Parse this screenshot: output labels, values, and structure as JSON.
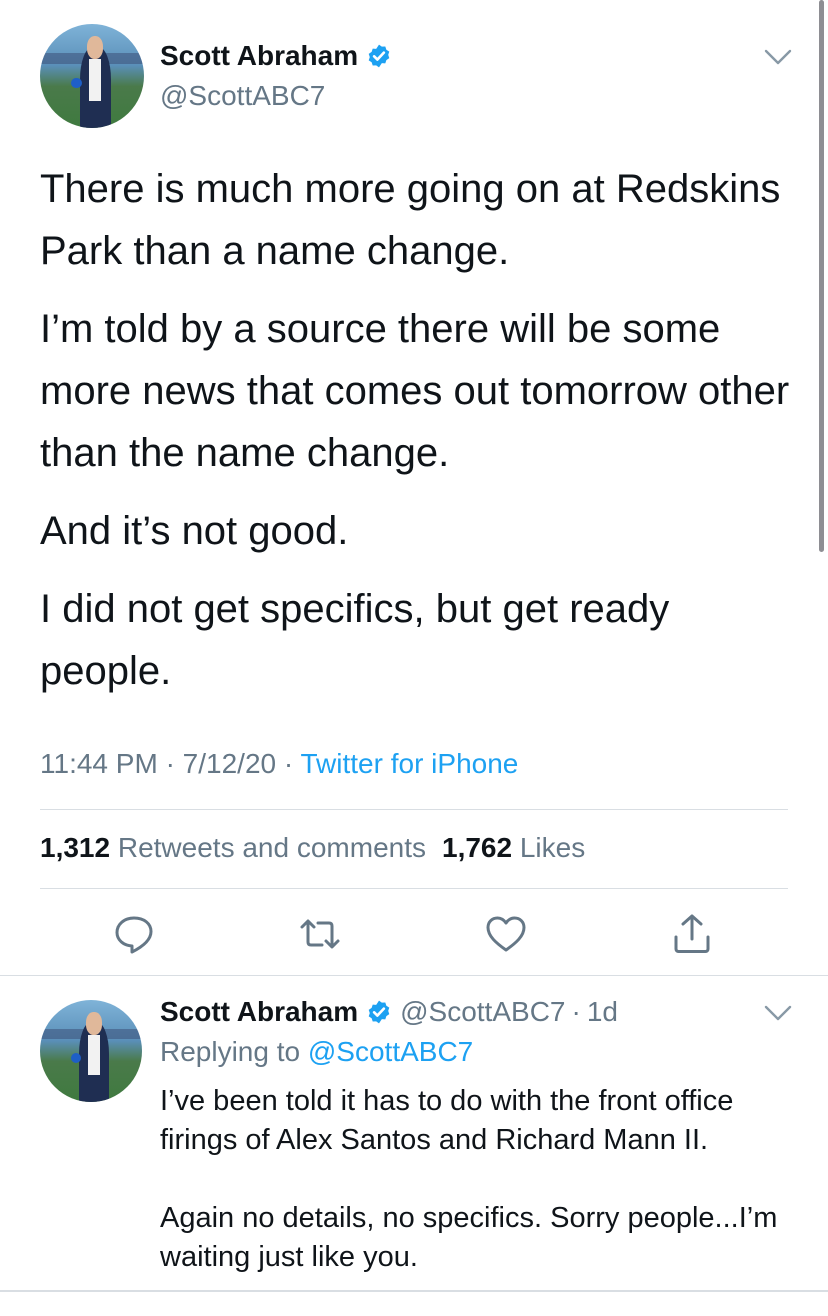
{
  "main_tweet": {
    "author_name": "Scott Abraham",
    "author_handle": "@ScottABC7",
    "paragraphs": [
      "There is much more going on at Redskins Park than a name change.",
      "I’m told by a source there will be some more news that comes out tomorrow other than the name change.",
      "And it’s not good.",
      "I did not get specifics, but get ready people."
    ],
    "time": "11:44 PM",
    "date": "7/12/20",
    "separator": "·",
    "source": "Twitter for iPhone",
    "retweets_count": "1,312",
    "retweets_label": "Retweets and comments",
    "likes_count": "1,762",
    "likes_label": "Likes"
  },
  "reply_tweet": {
    "author_name": "Scott Abraham",
    "author_handle": "@ScottABC7",
    "age": "1d",
    "replying_prefix": "Replying to",
    "replying_to": "@ScottABC7",
    "paragraphs": [
      "I’ve been told it has to do with the front office firings of Alex Santos and Richard Mann II.",
      "Again no details, no specifics. Sorry people...I’m waiting just like you."
    ]
  },
  "icons": {
    "verified": "verified-badge-icon",
    "chevron": "chevron-down-icon",
    "reply": "reply-icon",
    "retweet": "retweet-icon",
    "like": "heart-icon",
    "share": "share-icon"
  },
  "colors": {
    "accent": "#1da1f2",
    "text": "#0f1419",
    "secondary": "#657786",
    "divider": "#d9dee3"
  }
}
